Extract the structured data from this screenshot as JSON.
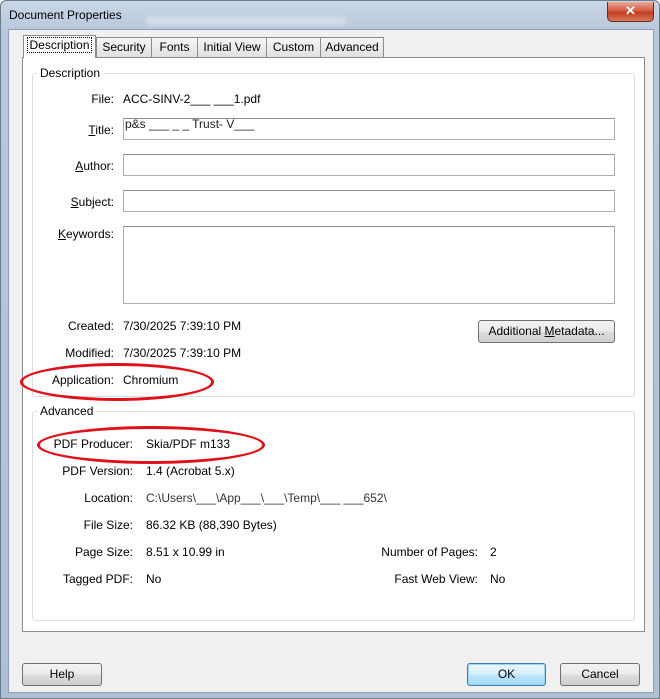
{
  "window": {
    "title": "Document Properties",
    "close_glyph": "✕"
  },
  "tabs": [
    {
      "label": "Description",
      "active": true
    },
    {
      "label": "Security"
    },
    {
      "label": "Fonts"
    },
    {
      "label": "Initial View"
    },
    {
      "label": "Custom"
    },
    {
      "label": "Advanced"
    }
  ],
  "description": {
    "legend": "Description",
    "file_label": "File:",
    "file_value": "ACC-SINV-2___ ___1.pdf",
    "title_label_key": "T",
    "title_label_rest": "itle:",
    "title_value": "p&s ___ _ _ Trust- V___",
    "author_label_key": "A",
    "author_label_rest": "uthor:",
    "author_value": "",
    "subject_label_key": "S",
    "subject_label_rest": "ubject:",
    "subject_value": "",
    "keywords_label_key": "K",
    "keywords_label_rest": "eywords:",
    "keywords_value": "",
    "created_label": "Created:",
    "created_value": "7/30/2025 7:39:10 PM",
    "modified_label": "Modified:",
    "modified_value": "7/30/2025 7:39:10 PM",
    "application_label": "Application:",
    "application_value": "Chromium",
    "metadata_button_prefix": "Additional ",
    "metadata_button_key": "M",
    "metadata_button_rest": "etadata..."
  },
  "advanced": {
    "legend": "Advanced",
    "producer_label": "PDF Producer:",
    "producer_value": "Skia/PDF m133",
    "version_label": "PDF Version:",
    "version_value": "1.4 (Acrobat 5.x)",
    "location_label": "Location:",
    "location_value": "C:\\Users\\___\\App___\\___\\Temp\\___ ___652\\",
    "filesize_label": "File Size:",
    "filesize_value": "86.32 KB (88,390 Bytes)",
    "pagesize_label": "Page Size:",
    "pagesize_value": "8.51 x 10.99 in",
    "numpages_label": "Number of Pages:",
    "numpages_value": "2",
    "tagged_label": "Tagged PDF:",
    "tagged_value": "No",
    "fastweb_label": "Fast Web View:",
    "fastweb_value": "No"
  },
  "buttons": {
    "help": "Help",
    "ok": "OK",
    "cancel": "Cancel"
  },
  "colors": {
    "highlight_ellipse": "#e0101a",
    "close_button": "#c23b22"
  }
}
